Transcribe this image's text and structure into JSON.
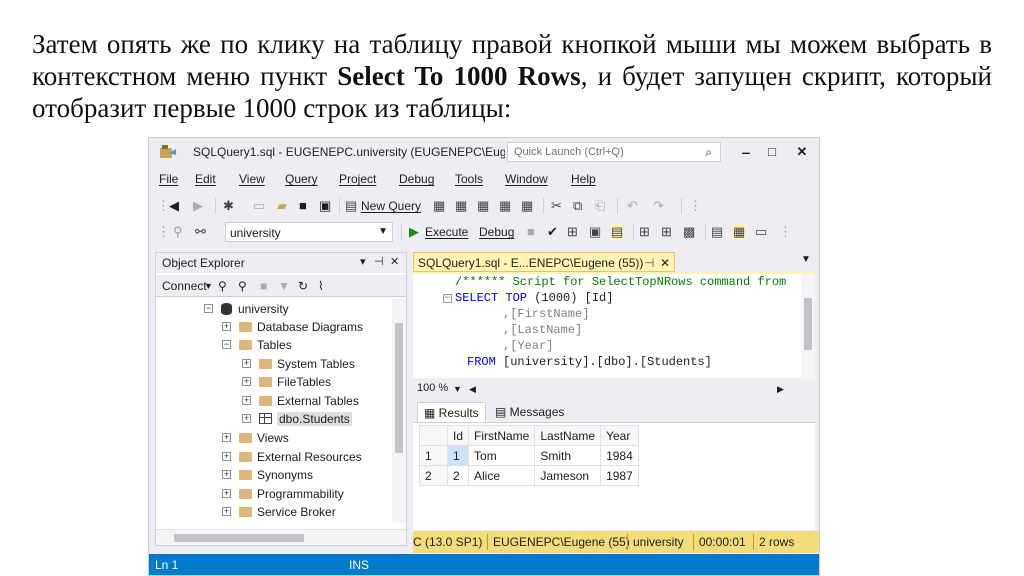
{
  "paragraph": {
    "part1": "Затем опять же по клику на таблицу правой кнопкой мыши мы можем выбрать в контекстном меню пункт ",
    "bold": "Select To 1000 Rows",
    "part2": ", и будет запущен скрипт, который отобразит первые 1000 строк из таблицы:"
  },
  "window": {
    "title": "SQLQuery1.sql - EUGENEPC.university (EUGENEPC\\Eug...",
    "quick_launch_placeholder": "Quick Launch (Ctrl+Q)",
    "minimize": "‒",
    "maximize": "□",
    "close": "✕"
  },
  "menu": [
    "File",
    "Edit",
    "View",
    "Query",
    "Project",
    "Debug",
    "Tools",
    "Window",
    "Help"
  ],
  "toolbar": {
    "new_query": "New Query",
    "database": "university",
    "execute": "Execute",
    "debug": "Debug"
  },
  "object_explorer": {
    "title": "Object Explorer",
    "connect": "Connect",
    "tree": {
      "database": "university",
      "database_diagrams": "Database Diagrams",
      "tables": "Tables",
      "system_tables": "System Tables",
      "file_tables": "FileTables",
      "external_tables": "External Tables",
      "dbo_students": "dbo.Students",
      "views": "Views",
      "external_resources": "External Resources",
      "synonyms": "Synonyms",
      "programmability": "Programmability",
      "service_broker": "Service Broker"
    }
  },
  "query_tab": {
    "label": "SQLQuery1.sql - E...ENEPC\\Eugene (55))",
    "pin": "⊣",
    "close": "✕"
  },
  "code": {
    "line1_comment": "/****** Script for SelectTopNRows command from",
    "line2_kw": "SELECT TOP",
    "line2_rest": " (1000) [Id]",
    "line3": ",[FirstName]",
    "line4": ",[LastName]",
    "line5": ",[Year]",
    "line6_kw": "FROM",
    "line6_rest": " [university].[dbo].[Students]"
  },
  "zoom": "100 %",
  "results": {
    "tab_results": "Results",
    "tab_messages": "Messages",
    "columns": [
      "Id",
      "FirstName",
      "LastName",
      "Year"
    ],
    "rows": [
      {
        "n": "1",
        "Id": "1",
        "FirstName": "Tom",
        "LastName": "Smith",
        "Year": "1984"
      },
      {
        "n": "2",
        "Id": "2",
        "FirstName": "Alice",
        "LastName": "Jameson",
        "Year": "1987"
      }
    ]
  },
  "query_status": {
    "version": "C (13.0 SP1)",
    "user": "EUGENEPC\\Eugene (55)",
    "database": "university",
    "time": "00:00:01",
    "rows": "2 rows"
  },
  "statusbar": {
    "line": "Ln 1",
    "mode": "INS"
  },
  "colors": {
    "status_blue": "#007acc",
    "tab_yellow": "#fff3b5",
    "query_status_yellow": "#f3dc7a",
    "keyword_blue": "#0000ff",
    "comment_green": "#008000"
  }
}
